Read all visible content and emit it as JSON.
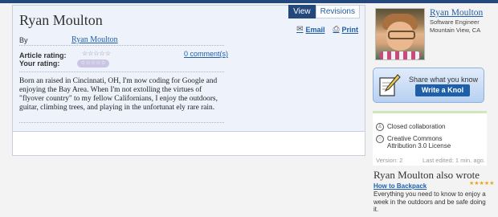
{
  "article": {
    "title": "Ryan Moulton",
    "tabs": [
      {
        "label": "View",
        "active": true
      },
      {
        "label": "Revisions",
        "active": false
      }
    ],
    "email_label": "Email",
    "print_label": "Print",
    "by_label": "By",
    "author_link": "Ryan Moulton",
    "article_rating_label": "Article rating:",
    "your_rating_label": "Your rating:",
    "article_stars": "☆☆☆☆☆",
    "your_stars": "☆☆☆☆☆",
    "comments_link": "0 comment(s)",
    "body": "Born an raised in Cincinnati, OH, I'm now coding for Google and enjoying the Bay Area. When I'm not extolling the virtues of \"flyover country\" to my fellow Californians, I enjoy the outdoors, guitar, climbing trees, and playing in the unfortunat ely rare rain."
  },
  "profile": {
    "name": "Ryan Moulton",
    "role": "Software Engineer",
    "location": "Mountain View, CA"
  },
  "share": {
    "text": "Share what you know",
    "button": "Write a Knol"
  },
  "info": {
    "collaboration": "Closed collaboration",
    "license_line1": "Creative Commons",
    "license_line2": "Attribution 3.0 License",
    "version": "Version: 2",
    "last_edited": "Last edited: 1 min. ago."
  },
  "also_wrote": {
    "heading": "Ryan Moulton also wrote",
    "items": [
      {
        "title": "How to Backpack",
        "stars": "★★★★★",
        "desc": "Everything you need to know to enjoy a week in the outdoors and be safe doing it."
      }
    ]
  },
  "colors": {
    "accent": "#24477c",
    "link": "#1f5fa8",
    "panel": "#eef2fb",
    "star": "#e6a817"
  }
}
